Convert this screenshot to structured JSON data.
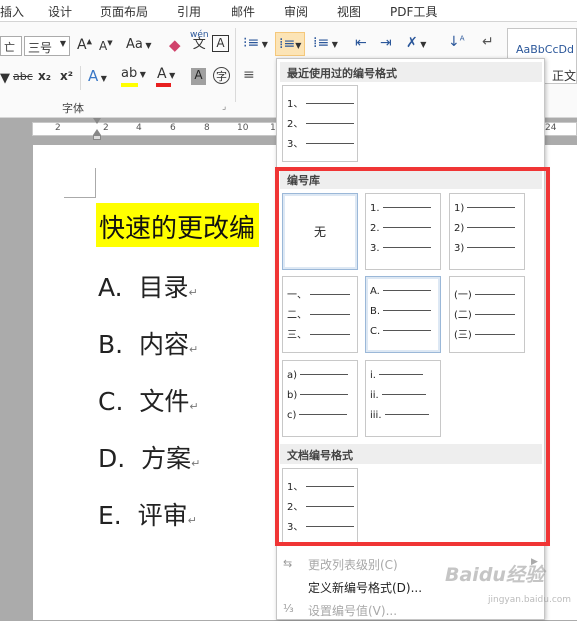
{
  "menubar": {
    "tabs": [
      "插入",
      "设计",
      "页面布局",
      "引用",
      "邮件",
      "审阅",
      "视图",
      "PDF工具"
    ]
  },
  "ribbon": {
    "font_size": "三号",
    "font_group_label": "字体",
    "style_preview": "AaBbCcDd",
    "wen": "wén",
    "grow_font": "A",
    "shrink_font": "A",
    "change_case": "Aa",
    "strikethrough": "abc",
    "subscript": "x₂",
    "superscript": "x²",
    "char_border": "A",
    "enclose_char": "字"
  },
  "ruler": {
    "ticks": [
      "2",
      "2",
      "4",
      "6",
      "8",
      "10",
      "12",
      "24"
    ]
  },
  "document": {
    "heading": "快速的更改编",
    "items": [
      {
        "label": "A.",
        "text": "目录"
      },
      {
        "label": "B.",
        "text": "内容"
      },
      {
        "label": "C.",
        "text": "文件"
      },
      {
        "label": "D.",
        "text": "方案"
      },
      {
        "label": "E.",
        "text": "评审"
      }
    ],
    "para_mark": "↵"
  },
  "dropdown": {
    "recent_header": "最近使用过的编号格式",
    "library_header": "编号库",
    "doc_header": "文档编号格式",
    "none_label": "无",
    "recent_tile": [
      "1、",
      "2、",
      "3、"
    ],
    "library_tiles": [
      [
        "1.",
        "2.",
        "3."
      ],
      [
        "1)",
        "2)",
        "3)"
      ],
      [
        "一、",
        "二、",
        "三、"
      ],
      [
        "A.",
        "B.",
        "C."
      ],
      [
        "(一)",
        "(二)",
        "(三)"
      ],
      [
        "a)",
        "b)",
        "c)"
      ],
      [
        "i.",
        "ii.",
        "iii."
      ]
    ],
    "doc_tile": [
      "1、",
      "2、",
      "3、"
    ],
    "menu": {
      "change_level": "更改列表级别(C)",
      "define_new": "定义新编号格式(D)...",
      "set_value": "设置编号值(V)..."
    }
  },
  "watermark": {
    "brand": "Baidu经验",
    "url": "jingyan.baidu.com"
  },
  "colors": {
    "highlight": "#ffff00",
    "red_frame": "#f03535",
    "font_color_bar": "#e81f1f",
    "highlight_bar": "#ffff00"
  }
}
